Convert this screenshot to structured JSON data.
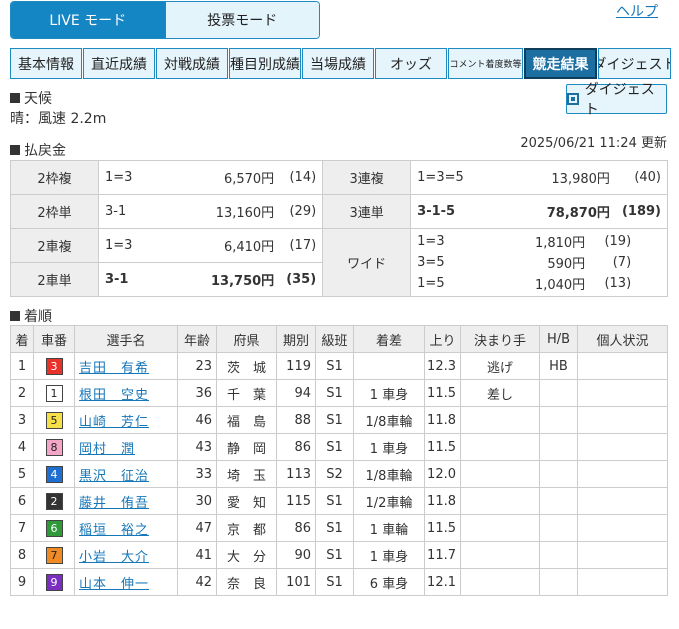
{
  "mode": {
    "live": "LIVE モード",
    "bet": "投票モード"
  },
  "help": "ヘルプ",
  "tabs": [
    "基本情報",
    "直近成績",
    "対戦成績",
    "種目別成績",
    "当場成績",
    "オッズ",
    "コメント着度数等",
    "競走結果",
    "ダイジェスト"
  ],
  "active_tab": "競走結果",
  "weather": {
    "title": "天候",
    "text": "晴：風速 2.2m"
  },
  "digest_button": "ダイジェスト",
  "payout_title": "払戻金",
  "updated": "2025/06/21 11:24 更新",
  "payout": {
    "rows": [
      {
        "type": "2枠複",
        "combo": "1=3",
        "yen": "6,570円",
        "pop": "(14)",
        "bold": false
      },
      {
        "type": "2枠単",
        "combo": "3-1",
        "yen": "13,160円",
        "pop": "(29)",
        "bold": false
      },
      {
        "type": "2車複",
        "combo": "1=3",
        "yen": "6,410円",
        "pop": "(17)",
        "bold": false
      },
      {
        "type": "2車単",
        "combo": "3-1",
        "yen": "13,750円",
        "pop": "(35)",
        "bold": true
      }
    ],
    "right_rows": [
      {
        "type": "3連複",
        "combo": "1=3=5",
        "yen": "13,980円",
        "pop": "(40)",
        "bold": false
      },
      {
        "type": "3連単",
        "combo": "3-1-5",
        "yen": "78,870円",
        "pop": "(189)",
        "bold": true
      }
    ],
    "wide": {
      "type": "ワイド",
      "entries": [
        {
          "combo": "1=3",
          "yen": "1,810円",
          "pop": "(19)"
        },
        {
          "combo": "3=5",
          "yen": "590円",
          "pop": "(7)"
        },
        {
          "combo": "1=5",
          "yen": "1,040円",
          "pop": "(13)"
        }
      ]
    }
  },
  "results_title": "着順",
  "results": {
    "headers": [
      "着",
      "車番",
      "選手名",
      "年齢",
      "府県",
      "期別",
      "級班",
      "着差",
      "上り",
      "決まり手",
      "H/B",
      "個人状況"
    ],
    "rows": [
      {
        "rank": "1",
        "car": "3",
        "name": "吉田　有希",
        "age": "23",
        "pref": "茨　城",
        "term": "119",
        "class": "S1",
        "margin": "",
        "agari": "12.3",
        "kimarite": "逃げ",
        "hb": "HB",
        "status": "",
        "car_bg": "#e8332b",
        "car_fg": "#ffffff"
      },
      {
        "rank": "2",
        "car": "1",
        "name": "根田　空史",
        "age": "36",
        "pref": "千　葉",
        "term": "94",
        "class": "S1",
        "margin": "1 車身",
        "agari": "11.5",
        "kimarite": "差し",
        "hb": "",
        "status": "",
        "car_bg": "#ffffff",
        "car_fg": "#222222"
      },
      {
        "rank": "3",
        "car": "5",
        "name": "山崎　芳仁",
        "age": "46",
        "pref": "福　島",
        "term": "88",
        "class": "S1",
        "margin": "1/8車輪",
        "agari": "11.8",
        "kimarite": "",
        "hb": "",
        "status": "",
        "car_bg": "#f5e04a",
        "car_fg": "#222222"
      },
      {
        "rank": "4",
        "car": "8",
        "name": "岡村　潤",
        "age": "43",
        "pref": "静　岡",
        "term": "86",
        "class": "S1",
        "margin": "1 車身",
        "agari": "11.5",
        "kimarite": "",
        "hb": "",
        "status": "",
        "car_bg": "#f4a6c8",
        "car_fg": "#222222"
      },
      {
        "rank": "5",
        "car": "4",
        "name": "黒沢　征治",
        "age": "33",
        "pref": "埼　玉",
        "term": "113",
        "class": "S2",
        "margin": "1/8車輪",
        "agari": "12.0",
        "kimarite": "",
        "hb": "",
        "status": "",
        "car_bg": "#1e6fd0",
        "car_fg": "#ffffff"
      },
      {
        "rank": "6",
        "car": "2",
        "name": "藤井　侑吾",
        "age": "30",
        "pref": "愛　知",
        "term": "115",
        "class": "S1",
        "margin": "1/2車輪",
        "agari": "11.8",
        "kimarite": "",
        "hb": "",
        "status": "",
        "car_bg": "#333333",
        "car_fg": "#ffffff"
      },
      {
        "rank": "7",
        "car": "6",
        "name": "稲垣　裕之",
        "age": "47",
        "pref": "京　都",
        "term": "86",
        "class": "S1",
        "margin": "1 車輪",
        "agari": "11.5",
        "kimarite": "",
        "hb": "",
        "status": "",
        "car_bg": "#2e9a3a",
        "car_fg": "#ffffff"
      },
      {
        "rank": "8",
        "car": "7",
        "name": "小岩　大介",
        "age": "41",
        "pref": "大　分",
        "term": "90",
        "class": "S1",
        "margin": "1 車身",
        "agari": "11.7",
        "kimarite": "",
        "hb": "",
        "status": "",
        "car_bg": "#f08a24",
        "car_fg": "#222222"
      },
      {
        "rank": "9",
        "car": "9",
        "name": "山本　伸一",
        "age": "42",
        "pref": "奈　良",
        "term": "101",
        "class": "S1",
        "margin": "6 車身",
        "agari": "12.1",
        "kimarite": "",
        "hb": "",
        "status": "",
        "car_bg": "#7a2fc0",
        "car_fg": "#ffffff"
      }
    ]
  }
}
